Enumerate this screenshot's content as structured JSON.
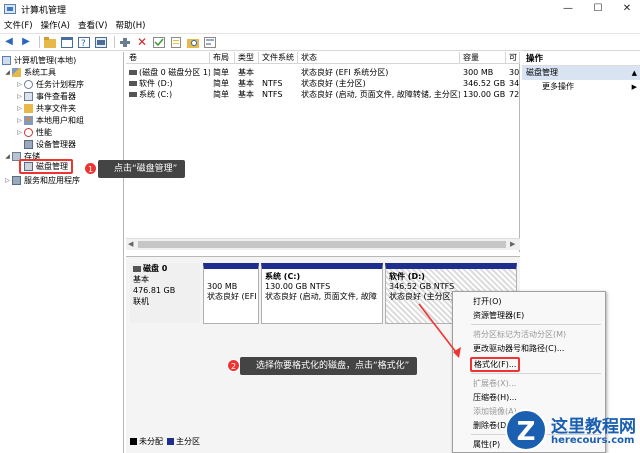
{
  "window": {
    "title": "计算机管理",
    "controls": {
      "minimize": "—",
      "maximize": "☐",
      "close": "✕"
    }
  },
  "menu": [
    "文件(F)",
    "操作(A)",
    "查看(V)",
    "帮助(H)"
  ],
  "toolbar": [
    "back-arrow-icon",
    "forward-arrow-icon",
    "up-folder-icon",
    "properties-grid-icon",
    "help-icon",
    "console-icon",
    "connect-icon",
    "delete-x-icon",
    "check-icon",
    "doc-icon",
    "search-folder-icon",
    "wizard-icon"
  ],
  "tree": {
    "root": "计算机管理(本地)",
    "system_tools": "系统工具",
    "task_scheduler": "任务计划程序",
    "event_viewer": "事件查看器",
    "shared_folders": "共享文件夹",
    "local_users": "本地用户和组",
    "performance": "性能",
    "device_manager": "设备管理器",
    "storage": "存储",
    "disk_management": "磁盘管理",
    "services": "服务和应用程序"
  },
  "volume_table": {
    "columns": [
      "卷",
      "布局",
      "类型",
      "文件系统",
      "状态",
      "容量",
      "可"
    ],
    "rows": [
      [
        "(磁盘 0 磁盘分区 1)",
        "简单",
        "基本",
        "",
        "状态良好 (EFI 系统分区)",
        "300 MB",
        "30"
      ],
      [
        "软件 (D:)",
        "简单",
        "基本",
        "NTFS",
        "状态良好 (主分区)",
        "346.52 GB",
        "34"
      ],
      [
        "系统 (C:)",
        "简单",
        "基本",
        "NTFS",
        "状态良好 (启动, 页面文件, 故障转储, 主分区)",
        "130.00 GB",
        "72"
      ]
    ]
  },
  "disk": {
    "name": "磁盘 0",
    "type": "基本",
    "size": "476.81 GB",
    "status": "联机",
    "partitions": [
      {
        "l1": "",
        "l2": "300 MB",
        "l3": "状态良好 (EFI"
      },
      {
        "l1": "系统 (C:)",
        "l2": "130.00 GB NTFS",
        "l3": "状态良好 (启动, 页面文件, 故障"
      },
      {
        "l1": "软件 (D:)",
        "l2": "346.52 GB NTFS",
        "l3": "状态良好 (主分区)"
      }
    ]
  },
  "legend": {
    "unallocated": "未分配",
    "primary": "主分区"
  },
  "actions": {
    "header": "操作",
    "section": "磁盘管理",
    "more": "更多操作"
  },
  "context_menu": [
    {
      "label": "打开(O)",
      "disabled": false
    },
    {
      "label": "资源管理器(E)",
      "disabled": false
    },
    {
      "label": "将分区标记为活动分区(M)",
      "disabled": true
    },
    {
      "label": "更改驱动器号和路径(C)...",
      "disabled": false
    },
    {
      "label": "格式化(F)...",
      "disabled": false
    },
    {
      "label": "扩展卷(X)...",
      "disabled": true
    },
    {
      "label": "压缩卷(H)...",
      "disabled": false
    },
    {
      "label": "添加镜像(A)...",
      "disabled": true
    },
    {
      "label": "删除卷(D)...",
      "disabled": false
    },
    {
      "label": "属性(P)",
      "disabled": false
    }
  ],
  "annotations": {
    "step1_num": "1",
    "step1_text": "点击“磁盘管理”",
    "step2_num": "2",
    "step2_text": "选择你要格式化的磁盘，点击“格式化”"
  },
  "watermark": {
    "mark": "Z",
    "name": "这里教程网",
    "url": "herecours.com"
  },
  "colors": {
    "primary_partition": "#1f2d8f",
    "unallocated": "#000000",
    "highlight": "#e33333",
    "selection": "#d9e4f3"
  }
}
